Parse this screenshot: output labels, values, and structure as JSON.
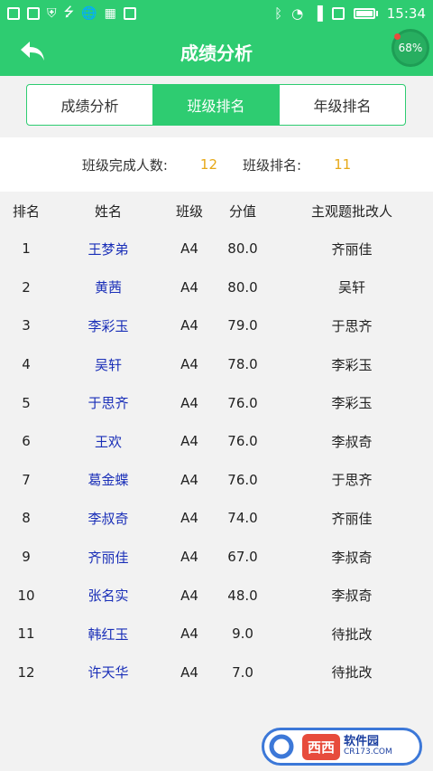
{
  "status_bar": {
    "time": "15:34",
    "left_icons": [
      "sim-icon",
      "image-icon",
      "shield-icon",
      "usb-icon",
      "globe-icon",
      "grid-icon",
      "s-icon"
    ],
    "right_icons": [
      "bluetooth-icon",
      "wifi-icon",
      "signal-icon",
      "sim-icon",
      "battery-icon"
    ]
  },
  "header": {
    "title": "成绩分析",
    "speed_badge": "68%"
  },
  "tabs": [
    {
      "label": "成绩分析",
      "active": false
    },
    {
      "label": "班级排名",
      "active": true
    },
    {
      "label": "年级排名",
      "active": false
    }
  ],
  "summary": {
    "completed_label": "班级完成人数:",
    "completed_value": "12",
    "rank_label": "班级排名:",
    "rank_value": "11"
  },
  "table": {
    "columns": [
      "排名",
      "姓名",
      "班级",
      "分值",
      "主观题批改人"
    ],
    "rows": [
      {
        "rank": "1",
        "name": "王梦弟",
        "class": "A4",
        "score": "80.0",
        "grader": "齐丽佳"
      },
      {
        "rank": "2",
        "name": "黄茜",
        "class": "A4",
        "score": "80.0",
        "grader": "吴轩"
      },
      {
        "rank": "3",
        "name": "李彩玉",
        "class": "A4",
        "score": "79.0",
        "grader": "于思齐"
      },
      {
        "rank": "4",
        "name": "吴轩",
        "class": "A4",
        "score": "78.0",
        "grader": "李彩玉"
      },
      {
        "rank": "5",
        "name": "于思齐",
        "class": "A4",
        "score": "76.0",
        "grader": "李彩玉"
      },
      {
        "rank": "6",
        "name": "王欢",
        "class": "A4",
        "score": "76.0",
        "grader": "李叔奇"
      },
      {
        "rank": "7",
        "name": "葛金蝶",
        "class": "A4",
        "score": "76.0",
        "grader": "于思齐"
      },
      {
        "rank": "8",
        "name": "李叔奇",
        "class": "A4",
        "score": "74.0",
        "grader": "齐丽佳"
      },
      {
        "rank": "9",
        "name": "齐丽佳",
        "class": "A4",
        "score": "67.0",
        "grader": "李叔奇"
      },
      {
        "rank": "10",
        "name": "张名实",
        "class": "A4",
        "score": "48.0",
        "grader": "李叔奇"
      },
      {
        "rank": "11",
        "name": "韩红玉",
        "class": "A4",
        "score": "9.0",
        "grader": "待批改"
      },
      {
        "rank": "12",
        "name": "许天华",
        "class": "A4",
        "score": "7.0",
        "grader": "待批改"
      }
    ]
  },
  "watermark": {
    "brand": "西西",
    "cn": "软件园",
    "en": "CR173.COM"
  },
  "colors": {
    "primary": "#2ecc71",
    "name_link": "#1a2fb8",
    "summary_value": "#e6a817"
  }
}
